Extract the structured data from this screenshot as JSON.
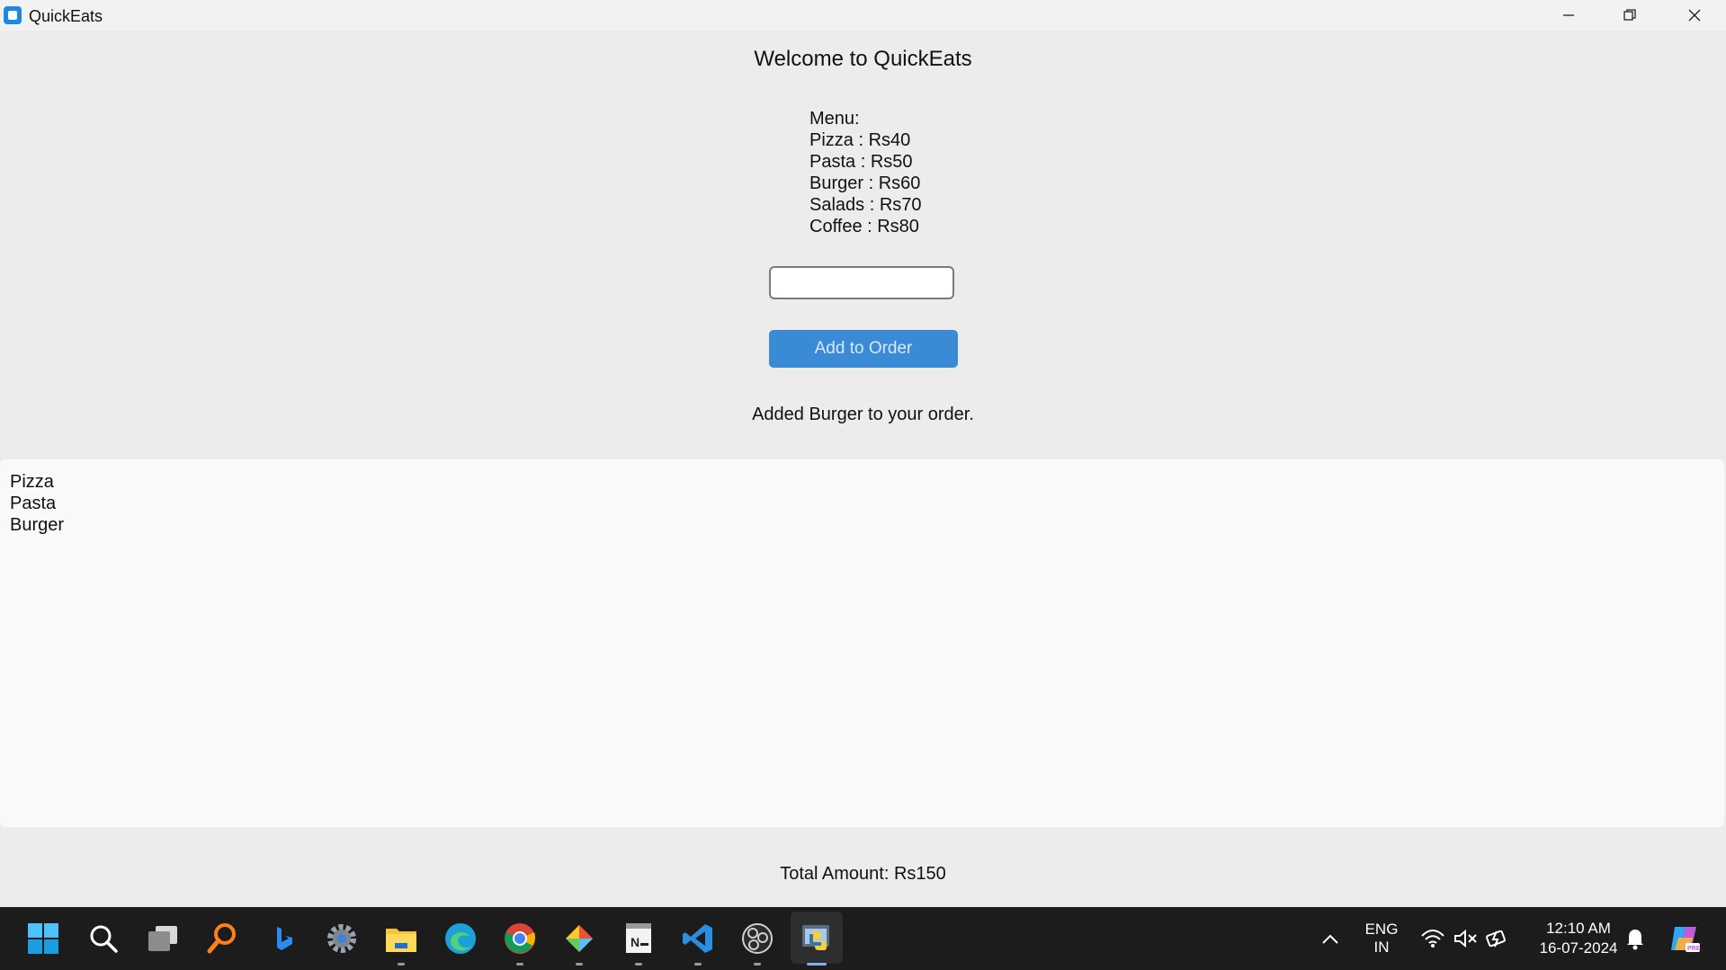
{
  "window": {
    "title": "QuickEats"
  },
  "main": {
    "welcome": "Welcome to QuickEats",
    "menu_heading": "Menu:",
    "menu_items": [
      "Pizza : Rs40",
      "Pasta : Rs50",
      "Burger : Rs60",
      "Salads : Rs70",
      "Coffee : Rs80"
    ],
    "order_input_value": "",
    "add_button_label": "Add to Order",
    "status_message": "Added Burger to your order.",
    "order_list": [
      "Pizza",
      "Pasta",
      "Burger"
    ],
    "total": "Total Amount: Rs150"
  },
  "taskbar": {
    "apps": [
      "start-icon",
      "search-icon",
      "task-view-icon",
      "everything-search-icon",
      "bing-icon",
      "settings-icon",
      "file-explorer-icon",
      "edge-icon",
      "chrome-icon",
      "git-icon",
      "notepad-plus-icon",
      "vscode-icon",
      "obs-icon",
      "python-icon"
    ],
    "language_line1": "ENG",
    "language_line2": "IN",
    "time": "12:10 AM",
    "date": "16-07-2024"
  },
  "colors": {
    "accent_button": "#3a8ad6",
    "window_bg": "#ececec",
    "list_bg": "#f9f9f9",
    "taskbar_bg": "#1c1c1c"
  }
}
